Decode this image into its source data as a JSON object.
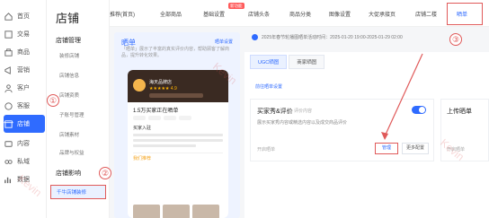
{
  "sidebar": {
    "items": [
      {
        "label": "首页",
        "icon": "home-icon"
      },
      {
        "label": "交易",
        "icon": "order-icon"
      },
      {
        "label": "商品",
        "icon": "goods-icon"
      },
      {
        "label": "营销",
        "icon": "marketing-icon"
      },
      {
        "label": "客户",
        "icon": "customer-icon"
      },
      {
        "label": "客服",
        "icon": "service-icon"
      },
      {
        "label": "店铺",
        "icon": "shop-icon"
      },
      {
        "label": "内容",
        "icon": "content-icon"
      },
      {
        "label": "私域",
        "icon": "private-icon"
      },
      {
        "label": "数据",
        "icon": "data-icon"
      }
    ]
  },
  "panel": {
    "title": "店铺",
    "group1": "店铺管理",
    "group1_items": [
      "装修店铺",
      "店铺信息",
      "店铺资质",
      "子账号管理",
      "店铺素材",
      "品牌与权益"
    ],
    "group2": "店铺影响",
    "active_item": "千牛店铺装修"
  },
  "topnav": {
    "items": [
      "推荐(首页)",
      "全部商品",
      "基础设置",
      "店铺头条",
      "商品分类",
      "图像设置",
      "大促承接页",
      "店铺二楼",
      "晒单"
    ],
    "badge": "新功能"
  },
  "notice": "2025年春节轮播图晒单活动时间：2025-01-20 19:00-2025-01-29 02:00",
  "preview": {
    "title": "晒单",
    "gear": "晒单设置",
    "desc": "「晒单」展示了丰富的真实评价内容，帮助顾客了解商品，提升转化效果。",
    "shop_name": "海天品牌店",
    "stars": "★★★★★ 4.9",
    "sub": "1.5万买家正在晒单",
    "user": "买家入驻",
    "rec_label": "我们推荐"
  },
  "tabs": [
    "UGC晒图",
    "商家晒图"
  ],
  "adv_link": "前往晒单设置",
  "card": {
    "title": "买家秀&评价",
    "sub": "评价内容",
    "desc": "展示买家秀内容或精选内容以及成交商品评价",
    "status": "开启晒单",
    "manage": "管理",
    "more": "更多配置"
  },
  "card2": {
    "title": "上传晒单",
    "status": "开启晒单"
  },
  "markers": [
    "①",
    "②",
    "③"
  ],
  "watermark": "Kevin"
}
